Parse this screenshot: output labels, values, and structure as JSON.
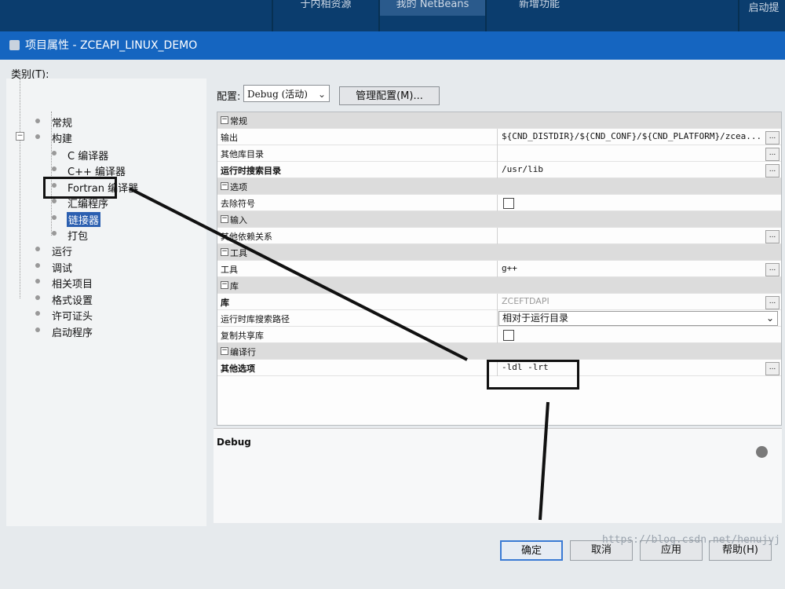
{
  "top_tabs": [
    {
      "label": "于内相资源",
      "active": false
    },
    {
      "label": "我的 NetBeans",
      "active": true
    },
    {
      "label": "新增功能",
      "active": false
    },
    {
      "label": "启动提",
      "active": false
    }
  ],
  "dialog": {
    "title": "项目属性 - ZCEAPI_LINUX_DEMO",
    "categories_label": "类别(T):",
    "tree": [
      {
        "label": "常规",
        "level": 0
      },
      {
        "label": "构建",
        "level": 0,
        "expanded": true
      },
      {
        "label": "C 编译器",
        "level": 1
      },
      {
        "label": "C++ 编译器",
        "level": 1
      },
      {
        "label": "Fortran 编译器",
        "level": 1
      },
      {
        "label": "汇编程序",
        "level": 1
      },
      {
        "label": "链接器",
        "level": 1,
        "selected": true
      },
      {
        "label": "打包",
        "level": 1
      },
      {
        "label": "运行",
        "level": 0
      },
      {
        "label": "调试",
        "level": 0
      },
      {
        "label": "相关项目",
        "level": 0
      },
      {
        "label": "格式设置",
        "level": 0
      },
      {
        "label": "许可证头",
        "level": 0
      },
      {
        "label": "启动程序",
        "level": 0
      }
    ],
    "config": {
      "label": "配置:",
      "value": "Debug (活动)",
      "manage_button": "管理配置(M)..."
    },
    "properties": [
      {
        "kind": "cat",
        "label": "常规"
      },
      {
        "kind": "prop",
        "label": "输出",
        "value": "${CND_DISTDIR}/${CND_CONF}/${CND_PLATFORM}/zcea...",
        "ellipsis": true
      },
      {
        "kind": "prop",
        "label": "其他库目录",
        "value": "",
        "ellipsis": true
      },
      {
        "kind": "prop",
        "label": "运行时搜索目录",
        "bold": true,
        "value": "/usr/lib",
        "ellipsis": true
      },
      {
        "kind": "cat",
        "label": "选项"
      },
      {
        "kind": "prop",
        "label": "去除符号",
        "checkbox": true
      },
      {
        "kind": "cat",
        "label": "输入"
      },
      {
        "kind": "prop",
        "label": "其他依赖关系",
        "value": "",
        "ellipsis": true
      },
      {
        "kind": "cat",
        "label": "工具"
      },
      {
        "kind": "prop",
        "label": "工具",
        "value": "g++",
        "ellipsis": true
      },
      {
        "kind": "cat",
        "label": "库"
      },
      {
        "kind": "prop",
        "label": "库",
        "bold": true,
        "value": "ZCEFTDAPI",
        "grey": true,
        "ellipsis": true
      },
      {
        "kind": "prop",
        "label": "运行时库搜索路径",
        "combo": "相对于运行目录"
      },
      {
        "kind": "prop",
        "label": "复制共享库",
        "checkbox": true
      },
      {
        "kind": "cat",
        "label": "编译行"
      },
      {
        "kind": "prop",
        "label": "其他选项",
        "bold": true,
        "value": "-ldl -lrt",
        "ellipsis": true
      }
    ],
    "description_title": "Debug",
    "buttons": {
      "ok": "确定",
      "cancel": "取消",
      "apply": "应用",
      "help": "帮助(H)"
    }
  },
  "watermark": "https://blog.csdn.net/henujyj"
}
